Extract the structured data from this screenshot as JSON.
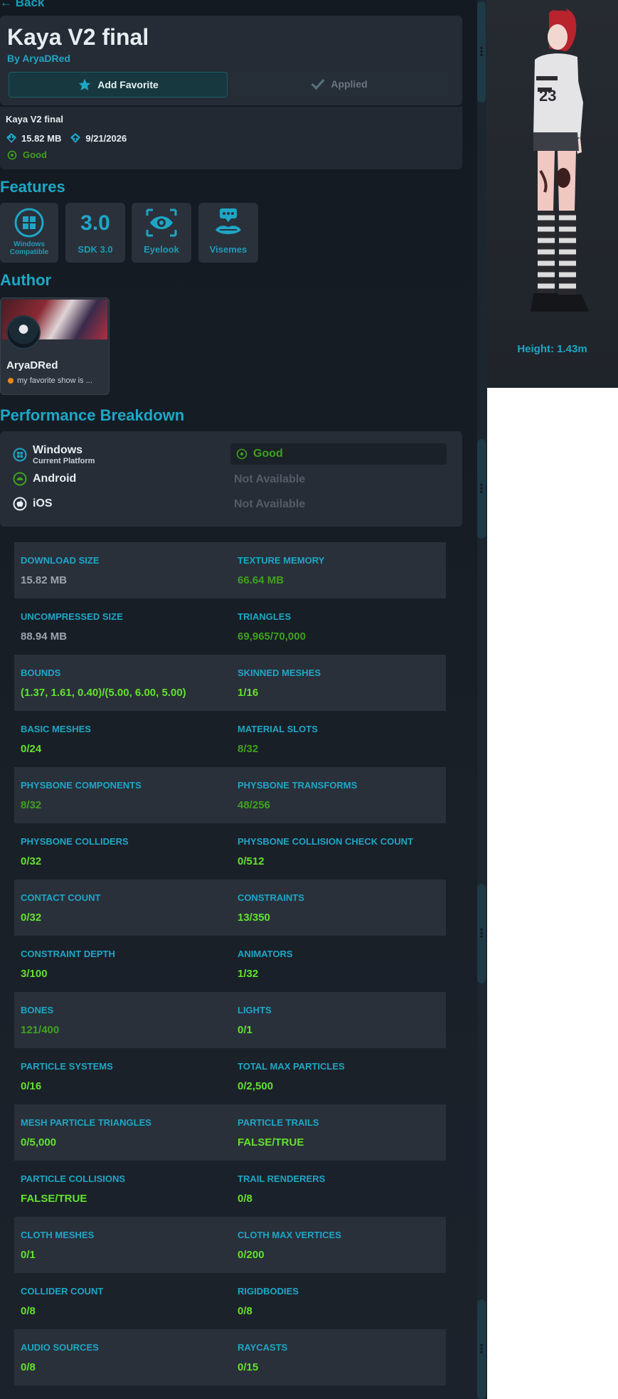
{
  "nav": {
    "back_label": "Back"
  },
  "header": {
    "title": "Kaya V2 final",
    "byline": "By AryaDRed",
    "favorite_label": "Add Favorite",
    "applied_label": "Applied"
  },
  "info": {
    "name": "Kaya V2 final",
    "size": "15.82 MB",
    "date": "9/21/2026",
    "rating": "Good"
  },
  "features": {
    "title": "Features",
    "items": [
      {
        "icon": "windows-icon",
        "label": "Windows Compatible"
      },
      {
        "icon": "sdk-icon",
        "badge": "3.0",
        "label": "SDK 3.0"
      },
      {
        "icon": "eyelook-icon",
        "label": "Eyelook"
      },
      {
        "icon": "visemes-icon",
        "label": "Visemes"
      }
    ]
  },
  "author": {
    "title": "Author",
    "name": "AryaDRed",
    "status": "my favorite show is ..."
  },
  "performance": {
    "title": "Performance Breakdown",
    "platforms": [
      {
        "name": "Windows",
        "sub": "Current Platform",
        "rating": "Good"
      },
      {
        "name": "Android",
        "rating": "Not Available"
      },
      {
        "name": "iOS",
        "rating": "Not Available"
      }
    ],
    "stats": [
      {
        "left": {
          "label": "DOWNLOAD SIZE",
          "value": "15.82 MB",
          "tone": "grey"
        },
        "right": {
          "label": "TEXTURE MEMORY",
          "value": "66.64 MB",
          "tone": "dgreen"
        }
      },
      {
        "left": {
          "label": "UNCOMPRESSED SIZE",
          "value": "88.94 MB",
          "tone": "grey"
        },
        "right": {
          "label": "TRIANGLES",
          "value": "69,965/70,000",
          "tone": "dgreen"
        }
      },
      {
        "left": {
          "label": "BOUNDS",
          "value": "(1.37, 1.61, 0.40)/(5.00, 6.00, 5.00)",
          "tone": "green"
        },
        "right": {
          "label": "SKINNED MESHES",
          "value": "1/16",
          "tone": "green"
        }
      },
      {
        "left": {
          "label": "BASIC MESHES",
          "value": "0/24",
          "tone": "green"
        },
        "right": {
          "label": "MATERIAL SLOTS",
          "value": "8/32",
          "tone": "dgreen"
        }
      },
      {
        "left": {
          "label": "PHYSBONE COMPONENTS",
          "value": "8/32",
          "tone": "dgreen"
        },
        "right": {
          "label": "PHYSBONE TRANSFORMS",
          "value": "48/256",
          "tone": "dgreen"
        }
      },
      {
        "left": {
          "label": "PHYSBONE COLLIDERS",
          "value": "0/32",
          "tone": "green"
        },
        "right": {
          "label": "PHYSBONE COLLISION CHECK COUNT",
          "value": "0/512",
          "tone": "green"
        }
      },
      {
        "left": {
          "label": "CONTACT COUNT",
          "value": "0/32",
          "tone": "green"
        },
        "right": {
          "label": "CONSTRAINTS",
          "value": "13/350",
          "tone": "green"
        }
      },
      {
        "left": {
          "label": "CONSTRAINT DEPTH",
          "value": "3/100",
          "tone": "green"
        },
        "right": {
          "label": "ANIMATORS",
          "value": "1/32",
          "tone": "green"
        }
      },
      {
        "left": {
          "label": "BONES",
          "value": "121/400",
          "tone": "dgreen"
        },
        "right": {
          "label": "LIGHTS",
          "value": "0/1",
          "tone": "green"
        }
      },
      {
        "left": {
          "label": "PARTICLE SYSTEMS",
          "value": "0/16",
          "tone": "green"
        },
        "right": {
          "label": "TOTAL MAX PARTICLES",
          "value": "0/2,500",
          "tone": "green"
        }
      },
      {
        "left": {
          "label": "MESH PARTICLE TRIANGLES",
          "value": "0/5,000",
          "tone": "green"
        },
        "right": {
          "label": "PARTICLE TRAILS",
          "value": "FALSE/TRUE",
          "tone": "green"
        }
      },
      {
        "left": {
          "label": "PARTICLE COLLISIONS",
          "value": "FALSE/TRUE",
          "tone": "green"
        },
        "right": {
          "label": "TRAIL RENDERERS",
          "value": "0/8",
          "tone": "green"
        }
      },
      {
        "left": {
          "label": "CLOTH MESHES",
          "value": "0/1",
          "tone": "green"
        },
        "right": {
          "label": "CLOTH MAX VERTICES",
          "value": "0/200",
          "tone": "green"
        }
      },
      {
        "left": {
          "label": "COLLIDER COUNT",
          "value": "0/8",
          "tone": "green"
        },
        "right": {
          "label": "RIGIDBODIES",
          "value": "0/8",
          "tone": "green"
        }
      },
      {
        "left": {
          "label": "AUDIO SOURCES",
          "value": "0/8",
          "tone": "green"
        },
        "right": {
          "label": "RAYCASTS",
          "value": "0/15",
          "tone": "green"
        }
      }
    ]
  },
  "preview": {
    "height_label": "Height: 1.43m"
  },
  "colors": {
    "accent": "#1ca8c6",
    "good": "#62e22c",
    "good_dim": "#3fa11c",
    "panel": "#252c36"
  }
}
